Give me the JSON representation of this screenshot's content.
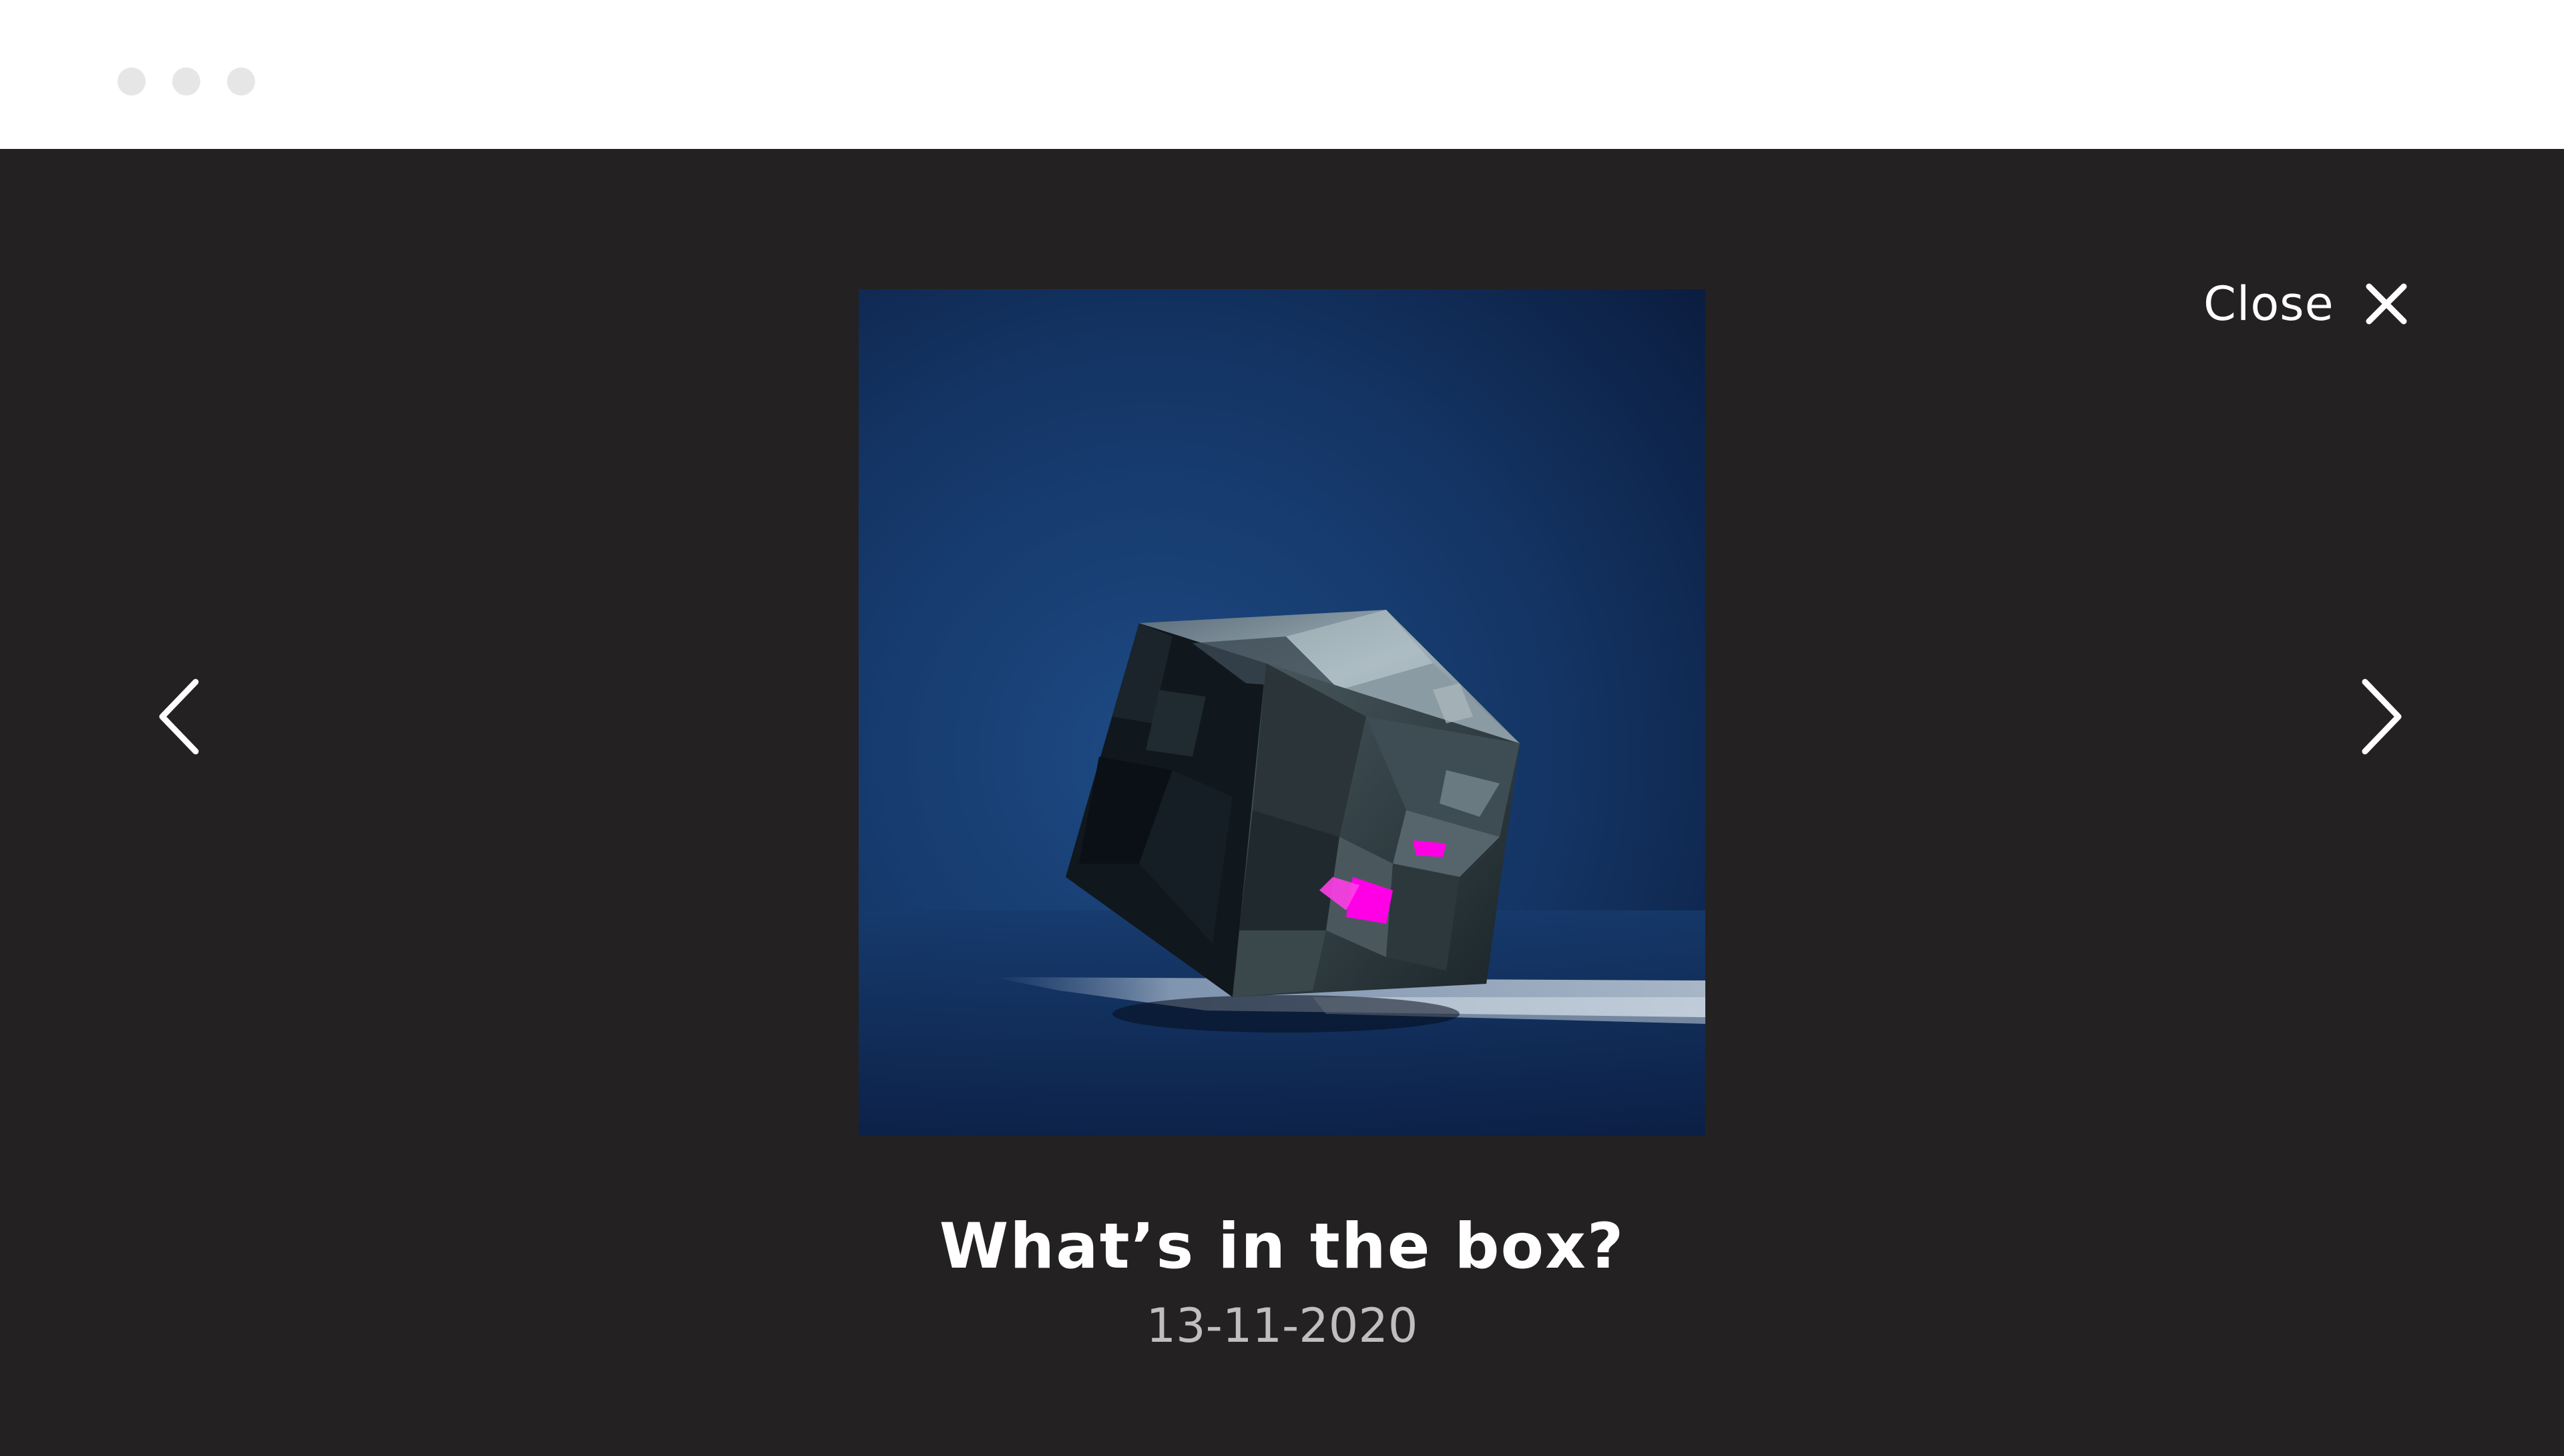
{
  "window": {
    "controls": [
      "window-dot",
      "window-dot",
      "window-dot"
    ]
  },
  "viewer": {
    "close_label": "Close",
    "close_icon": "close-icon",
    "prev_icon": "chevron-left-icon",
    "next_icon": "chevron-right-icon",
    "artwork_icon": "low-poly-box-artwork",
    "title": "What’s in the box?",
    "date": "13-11-2020"
  },
  "colors": {
    "background": "#242122",
    "accent": "#ff00e6",
    "artwork_backdrop": "#173a6e",
    "date_text": "#bfbfbf"
  }
}
